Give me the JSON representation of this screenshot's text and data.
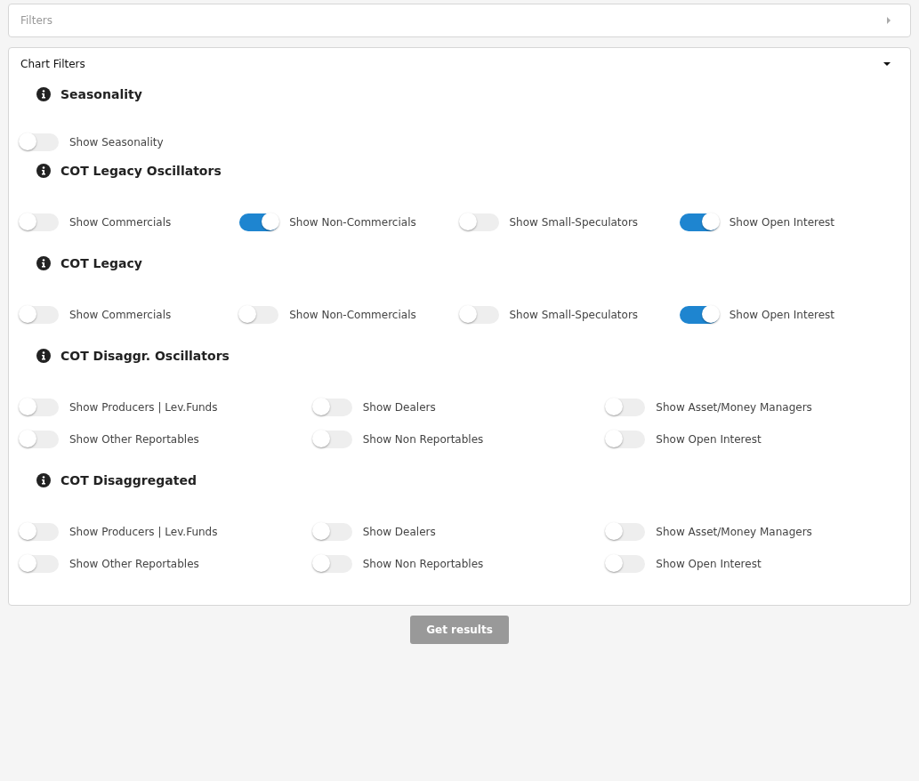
{
  "panels": [
    {
      "title": "Filters",
      "expanded": false
    },
    {
      "title": "Chart Filters",
      "expanded": true,
      "sections": [
        {
          "title": "Seasonality",
          "toggles": [
            {
              "label": "Show Seasonality",
              "on": false
            }
          ]
        },
        {
          "title": "COT Legacy Oscillators",
          "toggles": [
            {
              "label": "Show Commercials",
              "on": false
            },
            {
              "label": "Show Non-Commercials",
              "on": true
            },
            {
              "label": "Show Small-Speculators",
              "on": false
            },
            {
              "label": "Show Open Interest",
              "on": true
            }
          ]
        },
        {
          "title": "COT Legacy",
          "toggles": [
            {
              "label": "Show Commercials",
              "on": false
            },
            {
              "label": "Show Non-Commercials",
              "on": false
            },
            {
              "label": "Show Small-Speculators",
              "on": false
            },
            {
              "label": "Show Open Interest",
              "on": true
            }
          ]
        },
        {
          "title": "COT Disaggr. Oscillators",
          "toggles": [
            {
              "label": "Show Producers | Lev.Funds",
              "on": false
            },
            {
              "label": "Show Dealers",
              "on": false
            },
            {
              "label": "Show Asset/Money Managers",
              "on": false
            },
            {
              "label": "Show Other Reportables",
              "on": false
            },
            {
              "label": "Show Non Reportables",
              "on": false
            },
            {
              "label": "Show Open Interest",
              "on": false
            }
          ]
        },
        {
          "title": "COT Disaggregated",
          "toggles": [
            {
              "label": "Show Producers | Lev.Funds",
              "on": false
            },
            {
              "label": "Show Dealers",
              "on": false
            },
            {
              "label": "Show Asset/Money Managers",
              "on": false
            },
            {
              "label": "Show Other Reportables",
              "on": false
            },
            {
              "label": "Show Non Reportables",
              "on": false
            },
            {
              "label": "Show Open Interest",
              "on": false
            }
          ]
        }
      ]
    }
  ],
  "submit_button": "Get results"
}
